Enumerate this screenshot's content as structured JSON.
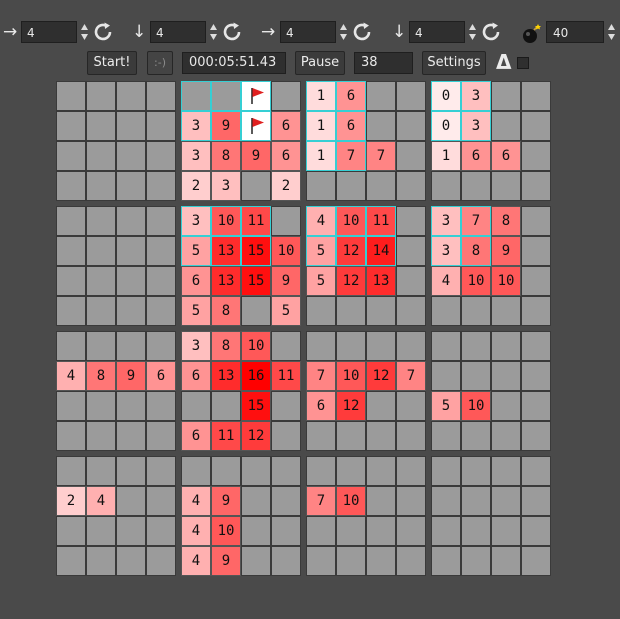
{
  "toolbar": {
    "dims": [
      {
        "arrow": "→",
        "arrow_icon": "arrow-right-icon",
        "value": "4"
      },
      {
        "arrow": "↓",
        "arrow_icon": "arrow-down-icon",
        "value": "4"
      },
      {
        "arrow": "→",
        "arrow_icon": "arrow-right-icon",
        "value": "4"
      },
      {
        "arrow": "↓",
        "arrow_icon": "arrow-down-icon",
        "value": "4"
      }
    ],
    "mines": "40",
    "start_label": "Start!",
    "smiley_label": ":-)",
    "timer": "000:05:51.43",
    "pause_label": "Pause",
    "counter": "38",
    "settings_label": "Settings",
    "delta_label": "Δ"
  },
  "colors": {
    "closed": "#9b9b9b",
    "highlight": "#35cfd4",
    "flag": "#e02020"
  },
  "board": {
    "rows": [
      ". . . . | H H F . | 1 6 . . | 0 3 . .",
      ". . . . | 3 9 F 6 | 1 6 . . | 0 3 . .",
      ". . . . | 3 8 9 6 | 1 7 7 . | 1 6 6 .",
      ". . . . | 2 3 . 2 | . . . . | . . . .",
      ". . . . | 3 10 11 . | 4 10 11 . | 3 7 8 .",
      ". . . . | 5 13 15 10 | 5 12 14 . | 3 8 9 .",
      ". . . . | 6 13 15 9 | 5 12 13 . | 4 10 10 .",
      ". . . . | 5 8 . 5 | . . . . | . . . .",
      ". . . . | 3 8 10 . | . . . . | . . . .",
      "4 8 9 6 | 6 13 16 11 | 7 10 12 7 | . . . .",
      ". . . . | . . 15 . | 6 12 . . | 5 10 . .",
      ". . . . | 6 11 12 . | . . . . | . . . .",
      ". . . . | . . . . | . . . . | . . . .",
      "2 4 . . | 4 9 . . | 7 10 . . | . . . .",
      ". . . . | 4 10 . . | . . . . | . . . .",
      ". . . . | 4 9 . . | . . . . | . . . ."
    ],
    "highlighted": [
      [
        0,
        4
      ],
      [
        0,
        5
      ],
      [
        0,
        6
      ],
      [
        1,
        4
      ],
      [
        1,
        5
      ],
      [
        1,
        6
      ],
      [
        0,
        8
      ],
      [
        0,
        9
      ],
      [
        1,
        8
      ],
      [
        1,
        9
      ],
      [
        2,
        8
      ],
      [
        2,
        9
      ],
      [
        0,
        12
      ],
      [
        0,
        13
      ],
      [
        1,
        12
      ],
      [
        1,
        13
      ],
      [
        4,
        4
      ],
      [
        4,
        5
      ],
      [
        4,
        6
      ],
      [
        5,
        4
      ],
      [
        5,
        5
      ],
      [
        5,
        6
      ],
      [
        4,
        8
      ],
      [
        4,
        9
      ],
      [
        4,
        10
      ],
      [
        5,
        8
      ],
      [
        5,
        9
      ],
      [
        5,
        10
      ],
      [
        4,
        12
      ],
      [
        4,
        13
      ],
      [
        5,
        12
      ],
      [
        5,
        13
      ]
    ]
  }
}
